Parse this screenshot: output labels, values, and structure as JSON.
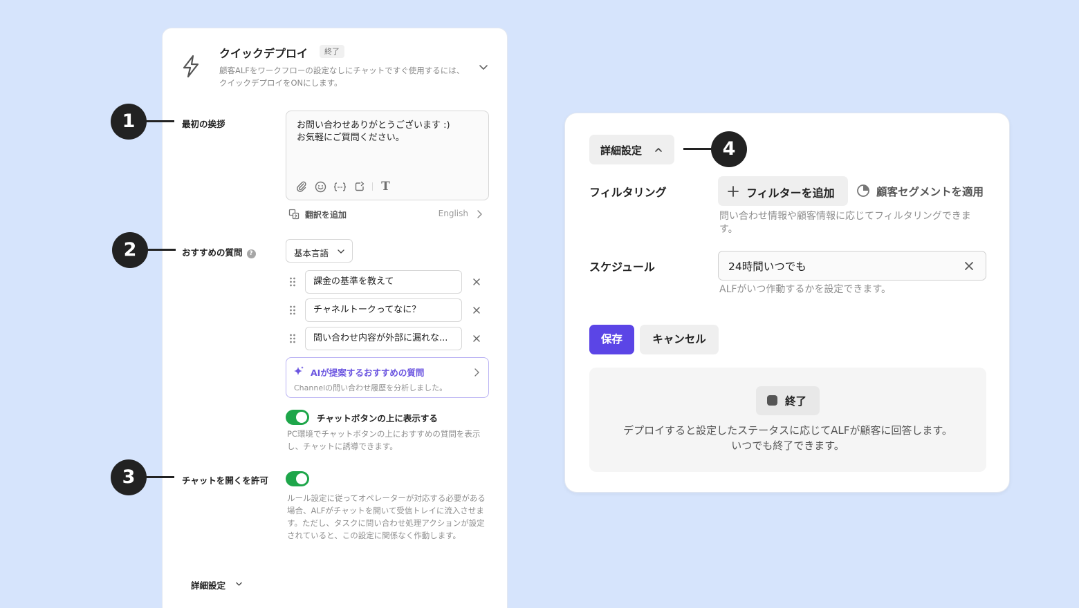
{
  "colors": {
    "background": "#d6e4fc",
    "primary": "#5b45e6",
    "toggle_on": "#1ea64a",
    "ai_accent": "#6b55e0",
    "callout": "#222222"
  },
  "quick_deploy": {
    "icon": "lightning-icon",
    "title": "クイックデプロイ",
    "badge": "終了",
    "description": "顧客ALFをワークフローの設定なしにチャットですぐ使用するには、クイックデプロイをONにします。"
  },
  "greeting": {
    "label": "最初の挨拶",
    "text": "お問い合わせありがとうございます :)\nお気軽にご質問ください。",
    "tools": [
      "paperclip-icon",
      "emoji-icon",
      "variable-icon",
      "refresh-icon",
      "text-format-icon"
    ],
    "translate_label": "翻訳を追加",
    "translate_language": "English"
  },
  "recommended": {
    "label": "おすすめの質問",
    "help": "?",
    "language_select": "基本言語",
    "questions": [
      "課金の基準を教えて",
      "チャネルトークってなに？",
      "問い合わせ内容が外部に漏れな..."
    ],
    "ai_card_title": "AIが提案するおすすめの質問",
    "ai_card_subtitle": "Channelの問い合わせ履歴を分析しました。",
    "show_above_label": "チャットボタンの上に表示する",
    "show_above_on": true,
    "show_above_help": "PC環境でチャットボタンの上におすすめの質問を表示し、チャットに誘導できます。"
  },
  "allow_chat": {
    "label": "チャットを開くを許可",
    "on": true,
    "help": "ルール設定に従ってオペレーターが対応する必要がある場合、ALFがチャットを開いて受信トレイに流入させます。ただし、タスクに問い合わせ処理アクションが設定されていると、この設定に関係なく作動します。"
  },
  "left_detail_label": "詳細設定",
  "callouts": [
    "1",
    "2",
    "3",
    "4"
  ],
  "detail_panel": {
    "toggle_label": "詳細設定",
    "filtering_label": "フィルタリング",
    "add_filter": "フィルターを追加",
    "apply_segment": "顧客セグメントを適用",
    "filtering_help": "問い合わせ情報や顧客情報に応じてフィルタリングできます。",
    "schedule_label": "スケジュール",
    "schedule_value": "24時間いつでも",
    "schedule_help": "ALFがいつ作動するかを設定できます。",
    "save": "保存",
    "cancel": "キャンセル",
    "status_chip": "終了",
    "status_text": "デプロイすると設定したステータスに応じてALFが顧客に回答します。\nいつでも終了できます。"
  }
}
